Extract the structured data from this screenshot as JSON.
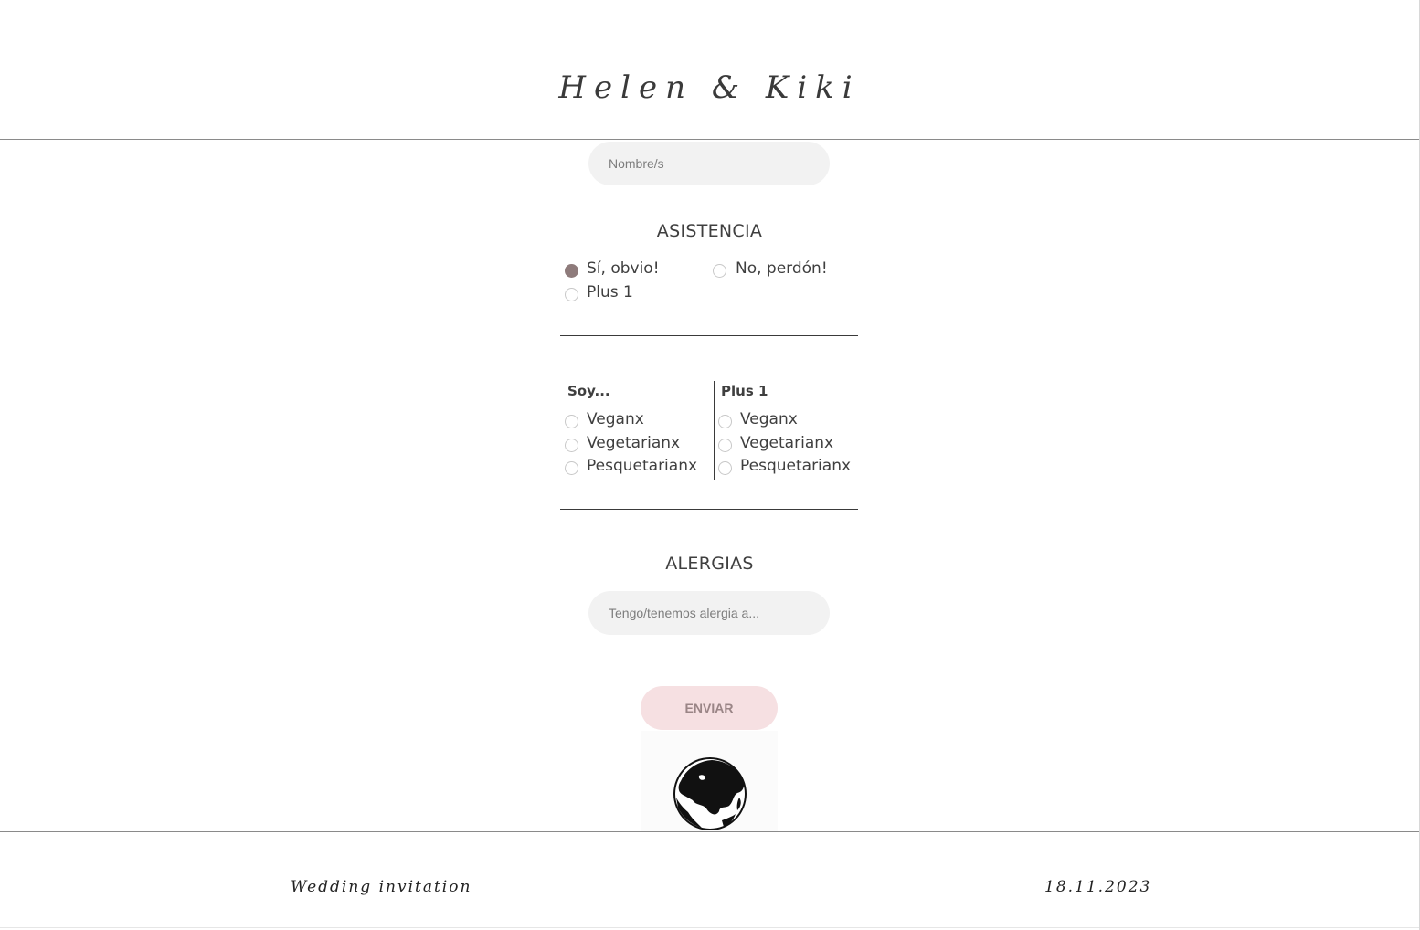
{
  "header": {
    "title": "Helen & Kiki"
  },
  "form": {
    "name_placeholder": "Nombre/s",
    "attendance": {
      "heading": "ASISTENCIA",
      "options": [
        "Sí, obvio!",
        "No, perdón!",
        "Plus 1"
      ],
      "selected": "Sí, obvio!"
    },
    "diet": {
      "columns": [
        {
          "title": "Soy...",
          "options": [
            "Veganx",
            "Vegetarianx",
            "Pesquetarianx"
          ]
        },
        {
          "title": "Plus 1",
          "options": [
            "Veganx",
            "Vegetarianx",
            "Pesquetarianx"
          ]
        }
      ]
    },
    "allergies": {
      "heading": "ALERGIAS",
      "placeholder": "Tengo/tenemos alergia a..."
    },
    "submit_label": "ENVIAR"
  },
  "icons": {
    "globe": "globe-icon"
  },
  "footer": {
    "left": "Wedding invitation",
    "right": "18.11.2023"
  },
  "colors": {
    "accent": "#8e7b7b",
    "button_bg": "#f6e0e2",
    "button_text": "#9a8586",
    "field_bg": "#f2f2f2"
  }
}
